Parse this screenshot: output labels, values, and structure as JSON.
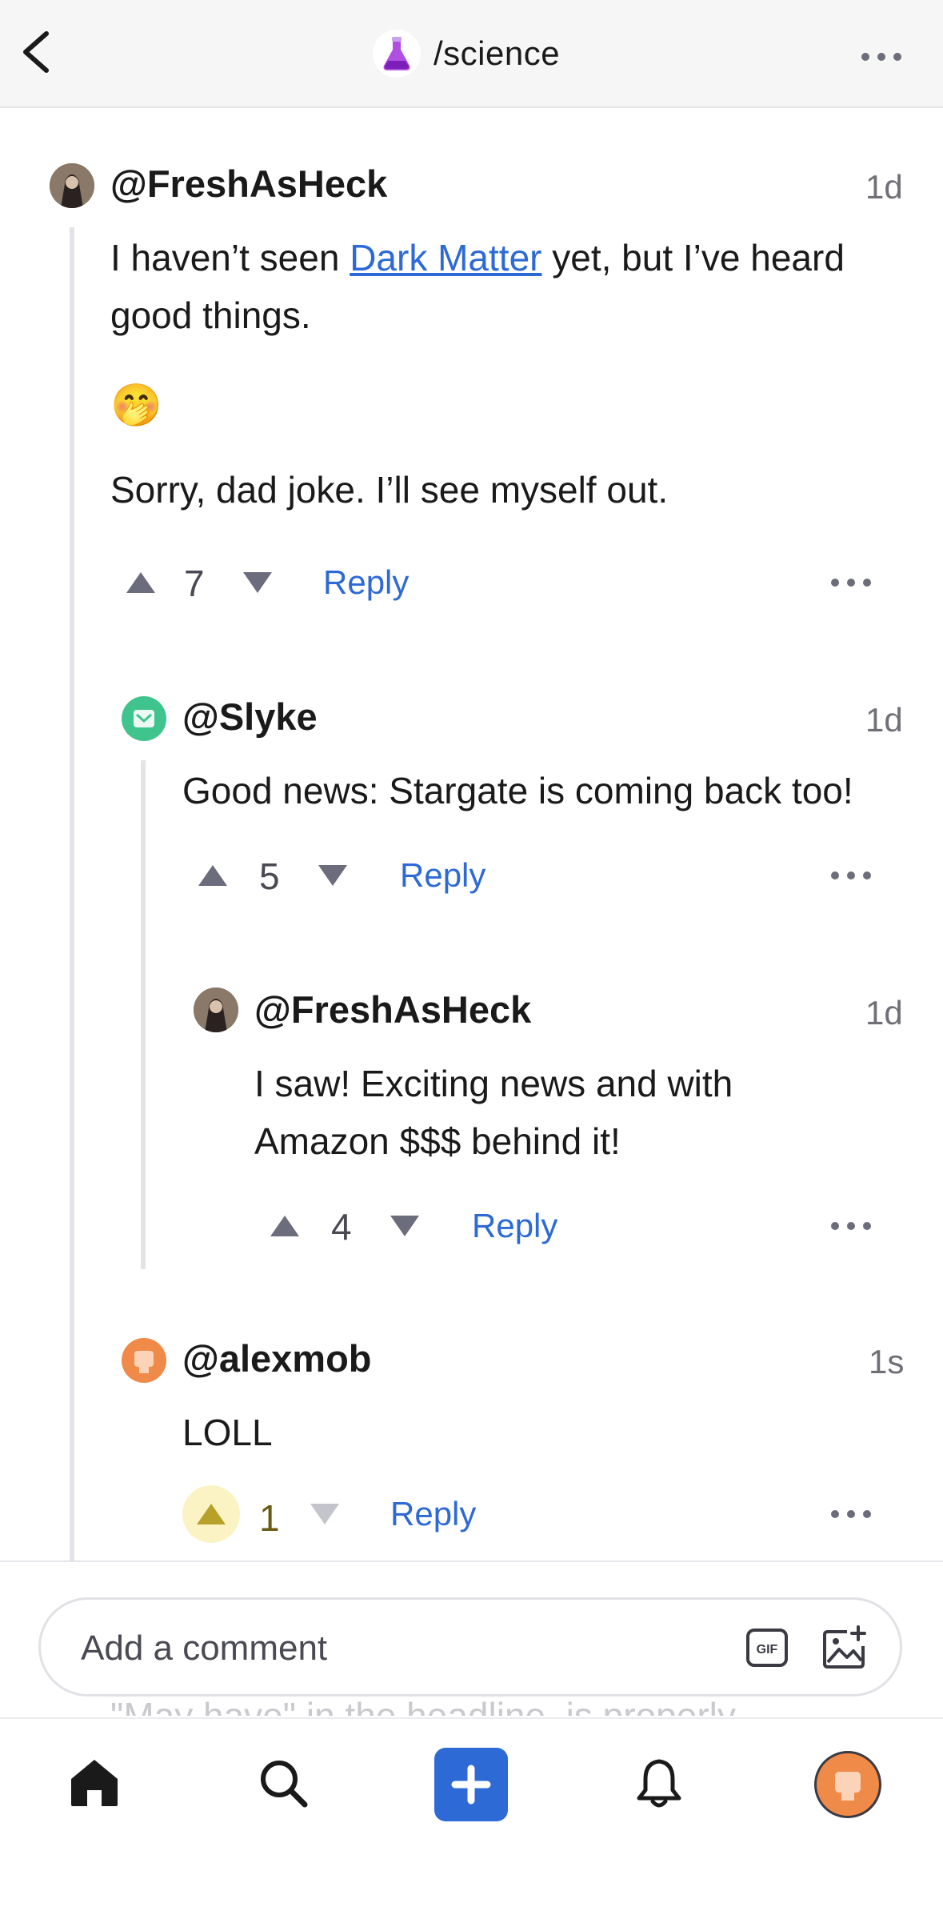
{
  "header": {
    "community_name": "/science",
    "back_icon": "chevron-left-icon",
    "community_icon": "flask-icon",
    "more_icon": "more-horizontal-icon"
  },
  "comments": [
    {
      "username": "@FreshAsHeck",
      "time": "1d",
      "body": {
        "line1_before_link": "I haven’t seen ",
        "link": "Dark Matter",
        "line1_after_link": " yet, but I’ve heard",
        "line2": "good things.",
        "emoji": "🤭",
        "line3": "Sorry, dad joke. I’ll see myself out."
      },
      "votes": "7",
      "reply_label": "Reply"
    },
    {
      "username": "@Slyke",
      "time": "1d",
      "body": "Good news: Stargate is coming back too!",
      "votes": "5",
      "reply_label": "Reply"
    },
    {
      "username": "@FreshAsHeck",
      "time": "1d",
      "body_line1": "I saw! Exciting news and with",
      "body_line2": "Amazon $$$ behind it!",
      "votes": "4",
      "reply_label": "Reply"
    },
    {
      "username": "@alexmob",
      "time": "1s",
      "body": "LOLL",
      "votes": "1",
      "upvoted": true,
      "reply_label": "Reply"
    }
  ],
  "composer": {
    "placeholder": "Add a comment",
    "gif_label": "GIF",
    "image_icon": "add-image-icon"
  },
  "background_text": "\"May have\" in the headline, is properly",
  "tabbar": {
    "items": [
      "home-icon",
      "search-icon",
      "create-post-icon",
      "notifications-icon",
      "profile-avatar"
    ]
  },
  "colors": {
    "accent": "#2d6ad6",
    "upvoted": "#b8a12a",
    "upvoted_bg": "#fbf3c4",
    "vote_arrow": "#6c6d7c",
    "thread_line": "#e4e4e8",
    "profile_avatar": "#f08a48",
    "slyke_avatar": "#3ec48c"
  }
}
